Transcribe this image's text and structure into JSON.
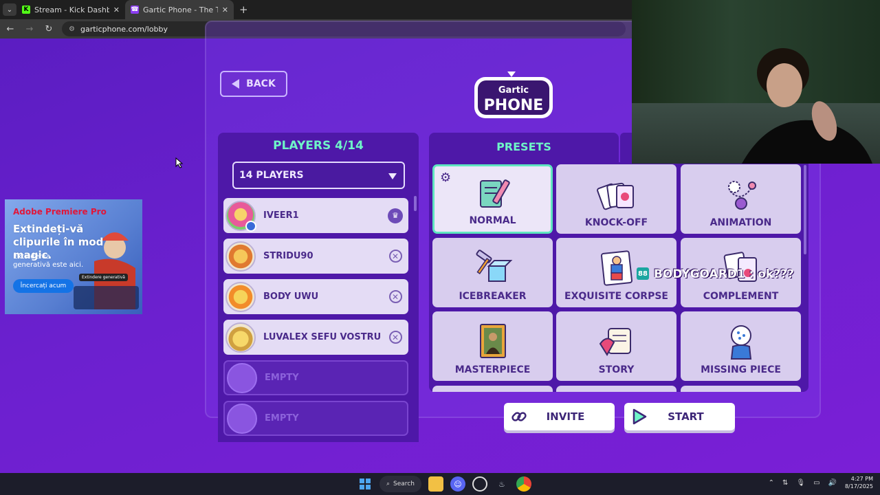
{
  "browser": {
    "tabs": [
      {
        "title": "Stream - Kick Dashboard",
        "icon": "kick-icon",
        "active": false
      },
      {
        "title": "Gartic Phone - The Telephone G",
        "icon": "gartic-icon",
        "active": true
      }
    ],
    "url": "garticphone.com/lobby"
  },
  "lobby": {
    "back_label": "BACK",
    "logo": {
      "top": "Gartic",
      "bottom": "PHONE"
    },
    "players_title": "PLAYERS 4/14",
    "players_select": "14 PLAYERS",
    "players": [
      {
        "name": "IVEER1",
        "action": "crown-icon",
        "avatar_color": "#e85a9a"
      },
      {
        "name": "STRIDU90",
        "action": "remove-icon",
        "avatar_color": "#f0a030"
      },
      {
        "name": "BODY UWU",
        "action": "remove-icon",
        "avatar_color": "#f28c2a"
      },
      {
        "name": "LUVALEX SEFU VOSTRU",
        "action": "remove-icon",
        "avatar_color": "#f4c84a"
      },
      {
        "name": "EMPTY",
        "action": "",
        "avatar_color": "#8a55e0"
      },
      {
        "name": "EMPTY",
        "action": "",
        "avatar_color": "#8a55e0"
      }
    ],
    "presets_title": "PRESETS",
    "presets": [
      {
        "label": "NORMAL",
        "selected": true
      },
      {
        "label": "KNOCK-OFF",
        "selected": false
      },
      {
        "label": "ANIMATION",
        "selected": false
      },
      {
        "label": "ICEBREAKER",
        "selected": false
      },
      {
        "label": "EXQUISITE CORPSE",
        "selected": false
      },
      {
        "label": "COMPLEMENT",
        "selected": false
      },
      {
        "label": "MASTERPIECE",
        "selected": false
      },
      {
        "label": "STORY",
        "selected": false
      },
      {
        "label": "MISSING PIECE",
        "selected": false
      }
    ],
    "invite_label": "INVITE",
    "start_label": "START"
  },
  "ad": {
    "brand": "Adobe Premiere Pro",
    "headline": "Extindeți-vă clipurile în mod magic.",
    "subtext": "Extinderea generativă este aici.",
    "cta": "Încercați acum",
    "tag": "Extindere generativă"
  },
  "overlay": {
    "text": "BODYGOARD1 : ok???"
  },
  "taskbar": {
    "search_label": "Search",
    "time": "4:27 PM",
    "date": "8/17/2025"
  },
  "colors": {
    "accent_green": "#6ff5c8",
    "page_purple": "#6a1fc8",
    "panel_purple": "#4e18a8"
  }
}
